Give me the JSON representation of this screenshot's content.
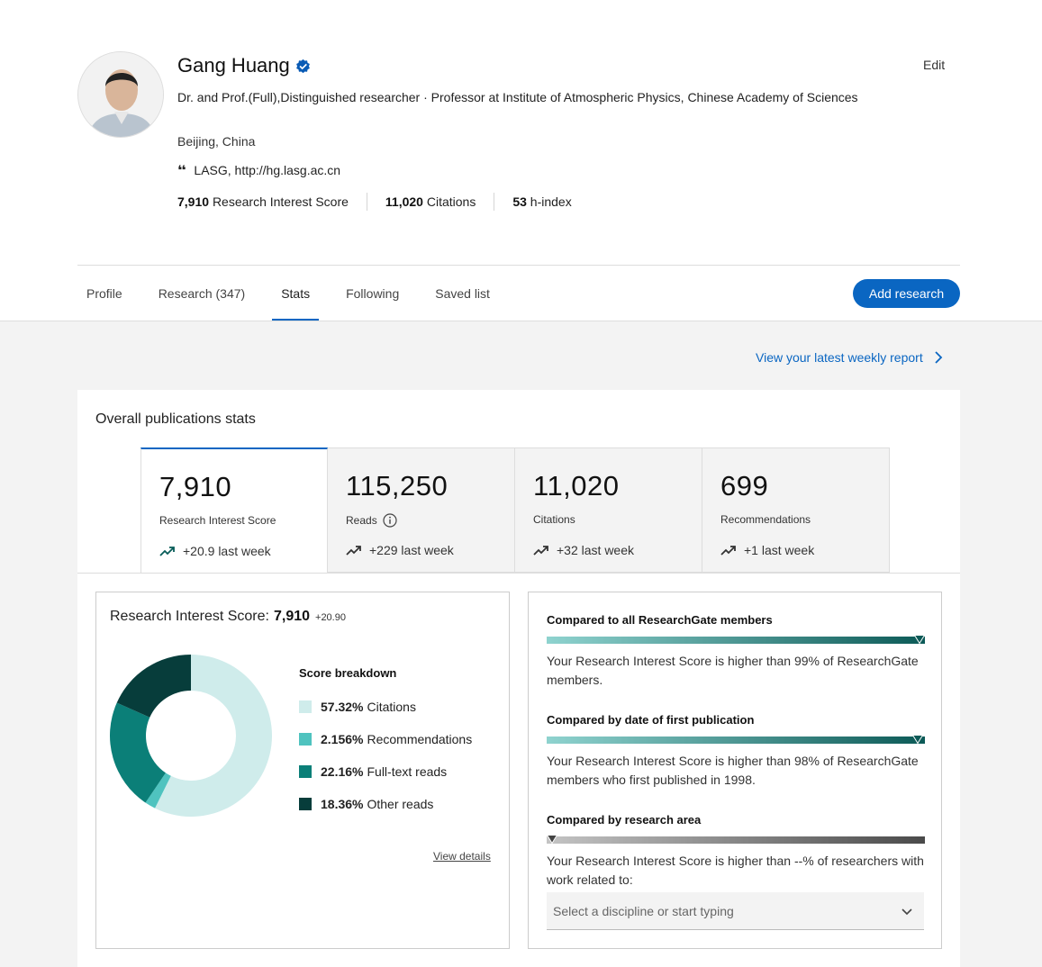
{
  "profile": {
    "name": "Gang Huang",
    "edit_label": "Edit",
    "headline": "Dr. and Prof.(Full),Distinguished researcher · Professor at Institute of Atmospheric Physics, Chinese Academy of Sciences",
    "location": "Beijing, China",
    "affiliation": "LASG, http://hg.lasg.ac.cn",
    "metrics": [
      {
        "value": "7,910",
        "label": "Research Interest Score"
      },
      {
        "value": "11,020",
        "label": "Citations"
      },
      {
        "value": "53",
        "label": "h-index"
      }
    ]
  },
  "tabs": [
    "Profile",
    "Research (347)",
    "Stats",
    "Following",
    "Saved list"
  ],
  "active_tab": "Stats",
  "add_research_label": "Add research",
  "weekly_report_label": "View your latest weekly report",
  "overall": {
    "title": "Overall publications stats",
    "cards": [
      {
        "value": "7,910",
        "label": "Research Interest Score",
        "delta": "+20.9 last week"
      },
      {
        "value": "115,250",
        "label": "Reads",
        "delta": "+229 last week"
      },
      {
        "value": "11,020",
        "label": "Citations",
        "delta": "+32 last week"
      },
      {
        "value": "699",
        "label": "Recommendations",
        "delta": "+1 last week"
      }
    ]
  },
  "ris": {
    "title": "Research Interest Score:",
    "value": "7,910",
    "change": "+20.90",
    "breakdown_title": "Score breakdown",
    "view_details": "View details",
    "colors": [
      "#cfeceb",
      "#4fc3bf",
      "#0b7f78",
      "#073d3b"
    ],
    "items": [
      {
        "pct": "57.32%",
        "label": "Citations"
      },
      {
        "pct": "2.156%",
        "label": "Recommendations"
      },
      {
        "pct": "22.16%",
        "label": "Full-text reads"
      },
      {
        "pct": "18.36%",
        "label": "Other reads"
      }
    ]
  },
  "chart_data": {
    "type": "pie",
    "categories": [
      "Citations",
      "Recommendations",
      "Full-text reads",
      "Other reads"
    ],
    "values": [
      57.32,
      2.156,
      22.16,
      18.36
    ]
  },
  "comparisons": [
    {
      "title": "Compared to all ResearchGate members",
      "text": "Your Research Interest Score is higher than 99% of ResearchGate members.",
      "percentile": 99
    },
    {
      "title": "Compared by date of first publication",
      "text": "Your Research Interest Score is higher than 98% of ResearchGate members who first published in 1998.",
      "percentile": 98
    },
    {
      "title": "Compared by research area",
      "text": "Your Research Interest Score is higher than --% of researchers with work related to:",
      "percentile": 0
    }
  ],
  "discipline_placeholder": "Select a discipline or start typing"
}
